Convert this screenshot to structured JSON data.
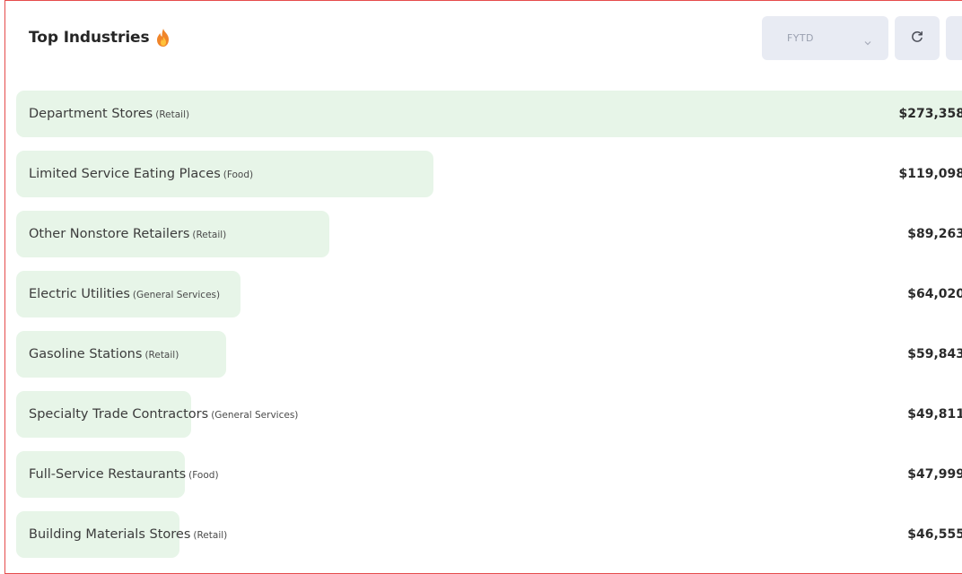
{
  "header": {
    "title": "Top Industries",
    "title_icon": "fire-icon",
    "period_select": {
      "value": "FYTD",
      "icon": "chevron-down-icon"
    },
    "refresh_button": {
      "icon": "refresh-icon"
    }
  },
  "colors": {
    "bar_fill": "#e7f5e8",
    "panel_border": "#e64b4b",
    "control_bg": "#e8ebf3"
  },
  "industries": [
    {
      "name": "Department Stores",
      "category": "(Retail)",
      "value_label": "$273,358",
      "value": 273358
    },
    {
      "name": "Limited Service Eating Places",
      "category": "(Food)",
      "value_label": "$119,098",
      "value": 119098
    },
    {
      "name": "Other Nonstore Retailers",
      "category": "(Retail)",
      "value_label": "$89,263",
      "value": 89263
    },
    {
      "name": "Electric Utilities",
      "category": "(General Services)",
      "value_label": "$64,020",
      "value": 64020
    },
    {
      "name": "Gasoline Stations",
      "category": "(Retail)",
      "value_label": "$59,843",
      "value": 59843
    },
    {
      "name": "Specialty Trade Contractors",
      "category": "(General Services)",
      "value_label": "$49,811",
      "value": 49811
    },
    {
      "name": "Full-Service Restaurants",
      "category": "(Food)",
      "value_label": "$47,999",
      "value": 47999
    },
    {
      "name": "Building Materials Stores",
      "category": "(Retail)",
      "value_label": "$46,555",
      "value": 46555
    }
  ]
}
